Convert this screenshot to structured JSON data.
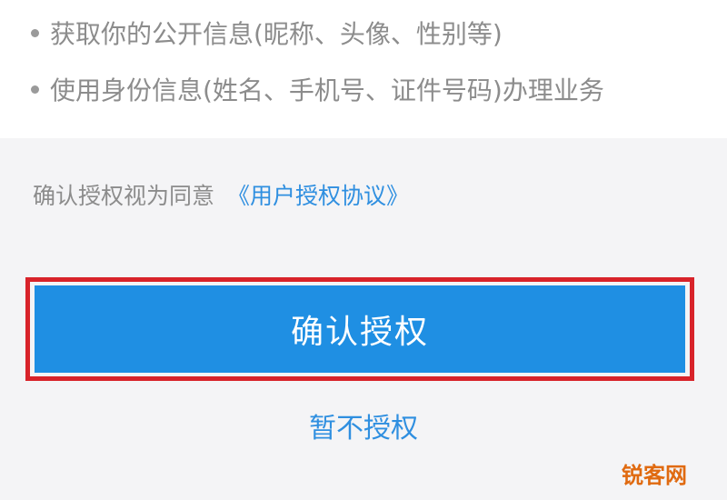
{
  "permissions": [
    {
      "text": "获取你的公开信息(昵称、头像、性别等)"
    },
    {
      "text": "使用身份信息(姓名、手机号、证件号码)办理业务"
    }
  ],
  "agreement": {
    "prefix": "确认授权视为同意",
    "link": "《用户授权协议》"
  },
  "buttons": {
    "confirm": "确认授权",
    "deny": "暂不授权"
  },
  "watermark": "锐客网",
  "colors": {
    "accent": "#1f8fe3",
    "link": "#2f8fe0",
    "highlight_border": "#d8232a"
  }
}
